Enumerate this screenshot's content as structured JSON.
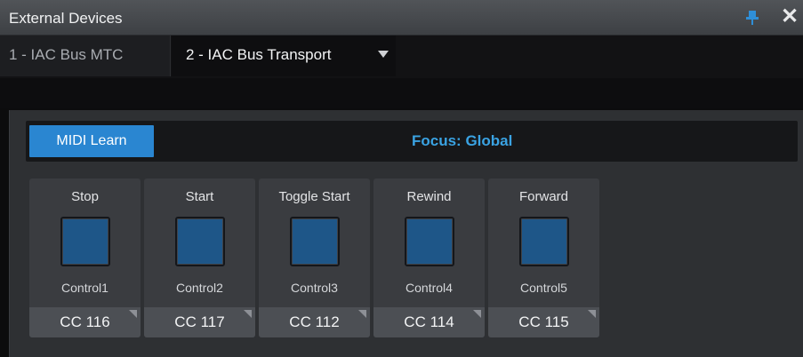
{
  "window": {
    "title": "External Devices",
    "pin_icon": "pin-icon",
    "close_icon": "close-icon",
    "close_glyph": "✕"
  },
  "tabs": [
    {
      "label": "1 - IAC Bus MTC"
    },
    {
      "label": "2 - IAC Bus Transport"
    }
  ],
  "toolbar": {
    "midi_learn_label": "MIDI Learn",
    "focus_label": "Focus: Global"
  },
  "controls": [
    {
      "label": "Stop",
      "name": "Control1",
      "cc": "CC 116"
    },
    {
      "label": "Start",
      "name": "Control2",
      "cc": "CC 117"
    },
    {
      "label": "Toggle Start",
      "name": "Control3",
      "cc": "CC 112"
    },
    {
      "label": "Rewind",
      "name": "Control4",
      "cc": "CC 114"
    },
    {
      "label": "Forward",
      "name": "Control5",
      "cc": "CC 115"
    }
  ],
  "colors": {
    "accent": "#2a86d1",
    "focus_text": "#3aa3e3",
    "pad": "#1e5688",
    "panel": "#2e3033"
  }
}
